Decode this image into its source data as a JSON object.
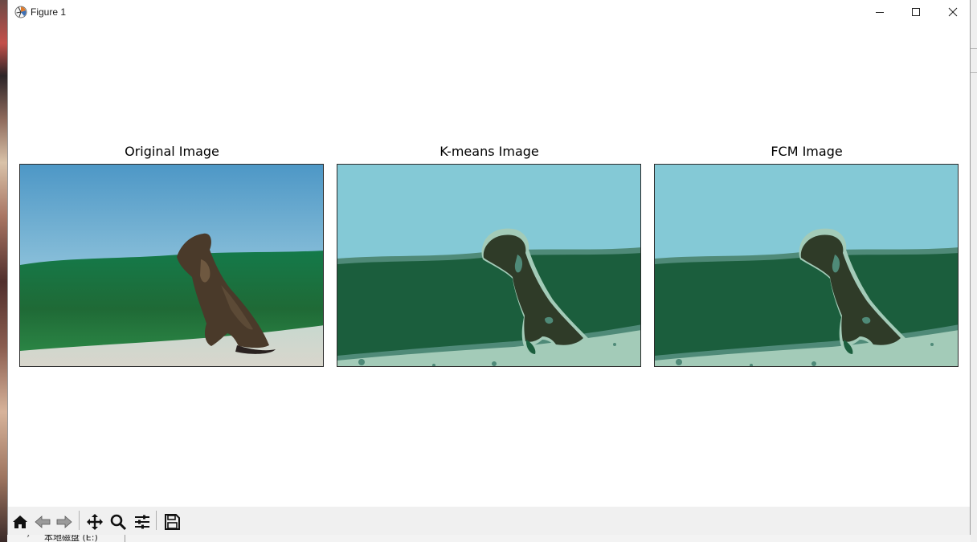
{
  "window": {
    "title": "Figure 1",
    "controls": [
      "minimize",
      "maximize",
      "close"
    ]
  },
  "figure": {
    "panels": [
      {
        "title": "Original Image"
      },
      {
        "title": "K-means Image"
      },
      {
        "title": "FCM Image"
      }
    ]
  },
  "toolbar": {
    "buttons": [
      {
        "icon": "home-icon"
      },
      {
        "icon": "back-arrow-icon"
      },
      {
        "icon": "forward-arrow-icon"
      },
      {
        "icon": "pan-icon"
      },
      {
        "icon": "zoom-icon"
      },
      {
        "icon": "configure-subplots-icon"
      },
      {
        "icon": "save-icon"
      }
    ]
  },
  "background": {
    "explorer_item": "本地磁盘 (E:)"
  },
  "colors": {
    "sky": "#84c9d6",
    "grass": "#1b5e3d",
    "ground": "#a3cbb8",
    "dog": "#2f3b28",
    "edge": "#4f8a78"
  }
}
